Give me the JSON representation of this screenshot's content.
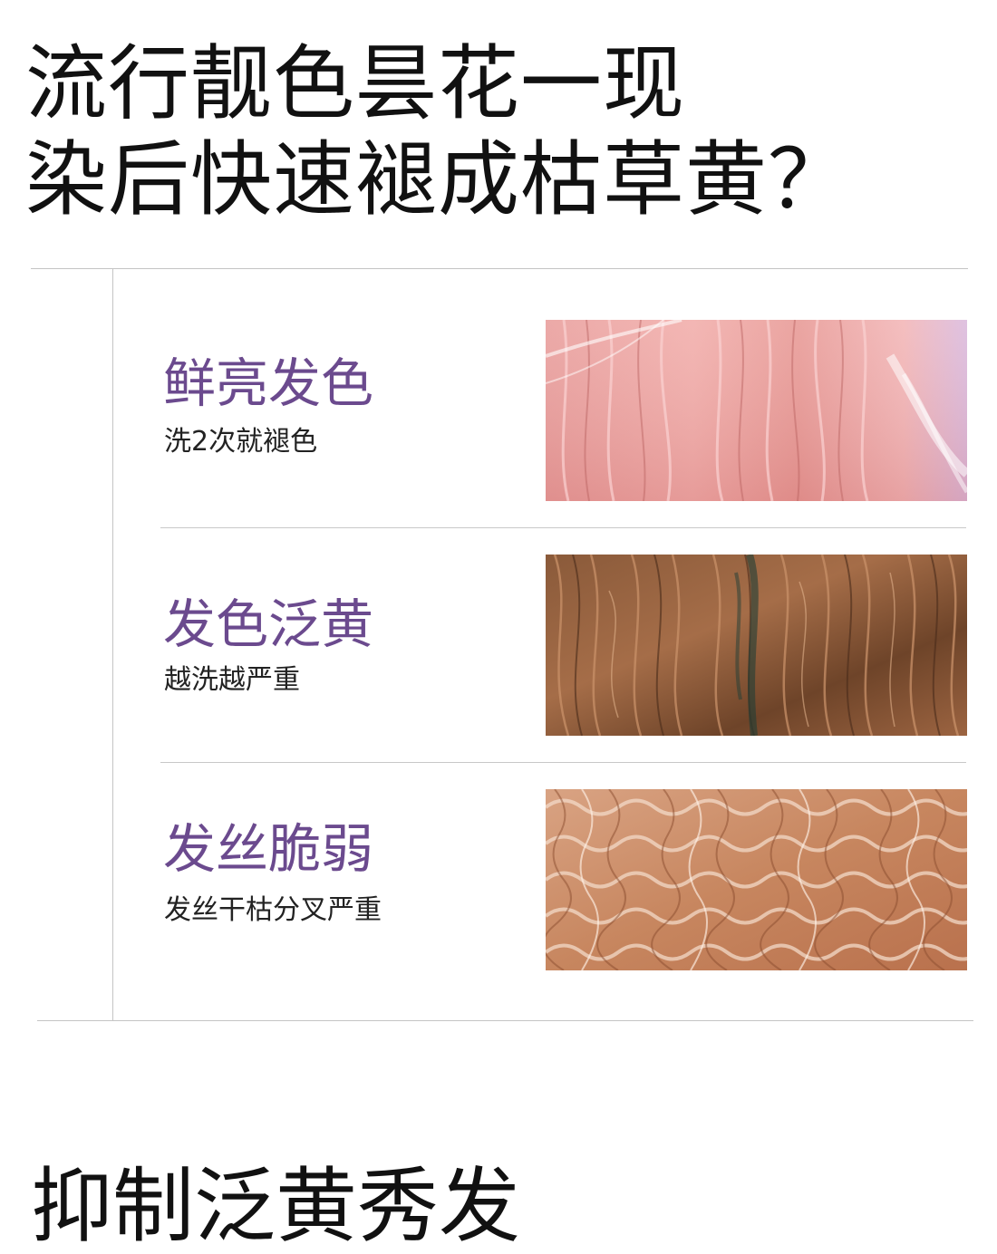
{
  "headline": {
    "line1": "流行靓色昙花一现",
    "line2": "染后快速褪成枯草黄？"
  },
  "issues": [
    {
      "title": "鲜亮发色",
      "desc": "洗2次就褪色",
      "photo_icon": "pink-hair-photo"
    },
    {
      "title": "发色泛黄",
      "desc": "越洗越严重",
      "photo_icon": "brassy-hair-photo"
    },
    {
      "title": "发丝脆弱",
      "desc": "发丝干枯分叉严重",
      "photo_icon": "damaged-curly-hair-photo"
    }
  ],
  "bottom_teaser": "抑制泛黄秀发",
  "colors": {
    "accent": "#6b4a8e",
    "text": "#111111",
    "rule": "#c4c4c4"
  }
}
